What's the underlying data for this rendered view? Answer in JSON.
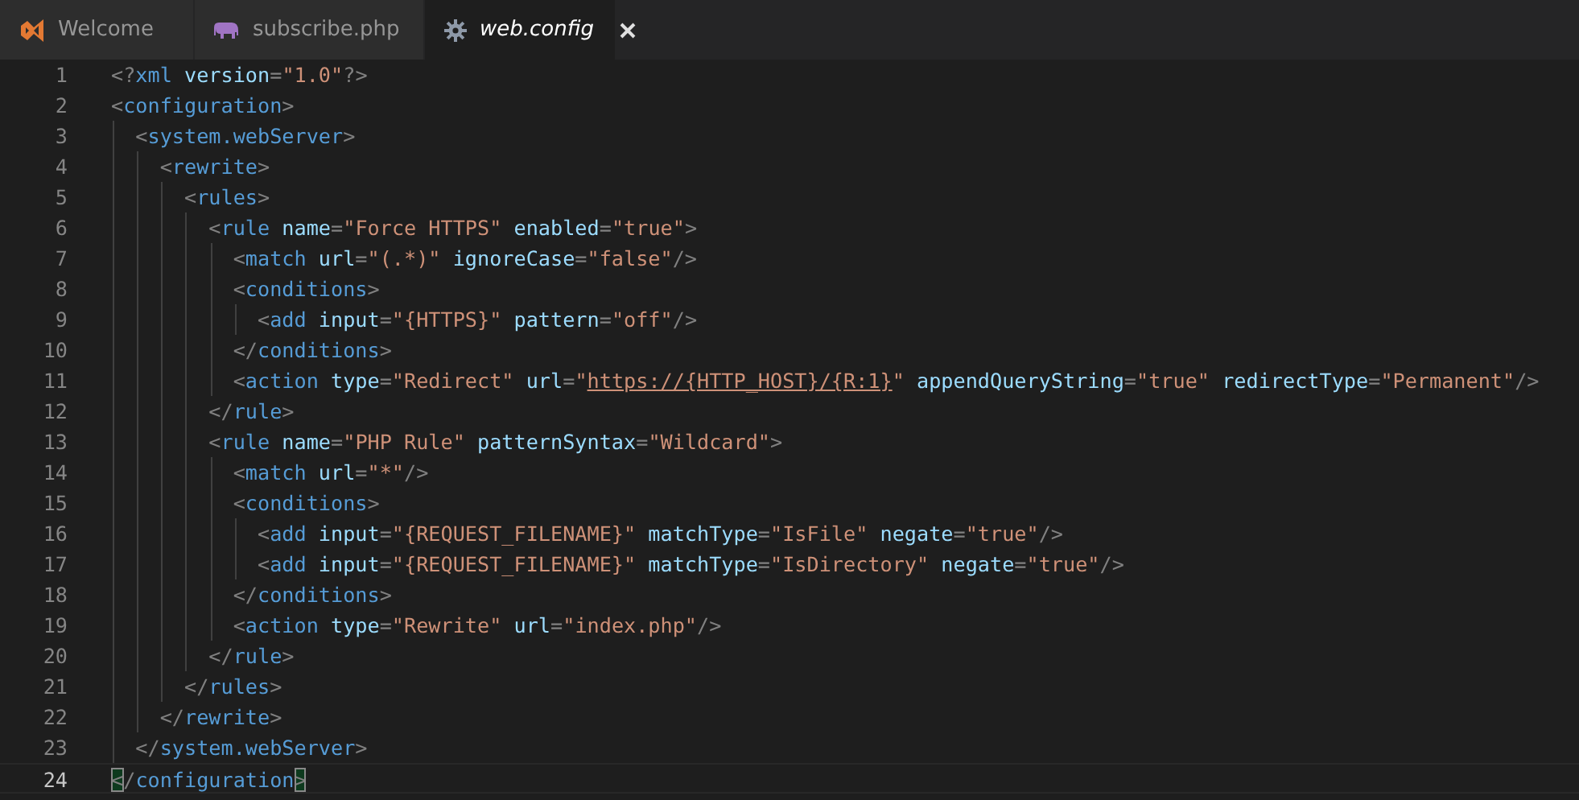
{
  "tabs": [
    {
      "label": "Welcome",
      "kind": "vs",
      "selected": false
    },
    {
      "label": "subscribe.php",
      "kind": "php",
      "selected": false
    },
    {
      "label": "web.config",
      "kind": "gear",
      "selected": true
    }
  ],
  "editor": {
    "lines": [
      {
        "number": "1",
        "current": false,
        "tokens": [
          {
            "kind": "punct",
            "text": "<?"
          },
          {
            "kind": "tag",
            "text": "xml"
          },
          {
            "kind": "attr",
            "text": " version"
          },
          {
            "kind": "punct",
            "text": "="
          },
          {
            "kind": "string",
            "text": "\"1.0\""
          },
          {
            "kind": "punct",
            "text": "?>"
          }
        ]
      },
      {
        "number": "2",
        "current": false,
        "tokens": [
          {
            "kind": "punct",
            "text": "<"
          },
          {
            "kind": "tag",
            "text": "configuration"
          },
          {
            "kind": "punct",
            "text": ">"
          }
        ]
      },
      {
        "number": "3",
        "current": false,
        "tokens": [
          {
            "kind": "punct",
            "text": "  <"
          },
          {
            "kind": "tag",
            "text": "system.webServer"
          },
          {
            "kind": "punct",
            "text": ">"
          }
        ]
      },
      {
        "number": "4",
        "current": false,
        "tokens": [
          {
            "kind": "punct",
            "text": "    <"
          },
          {
            "kind": "tag",
            "text": "rewrite"
          },
          {
            "kind": "punct",
            "text": ">"
          }
        ]
      },
      {
        "number": "5",
        "current": false,
        "tokens": [
          {
            "kind": "punct",
            "text": "      <"
          },
          {
            "kind": "tag",
            "text": "rules"
          },
          {
            "kind": "punct",
            "text": ">"
          }
        ]
      },
      {
        "number": "6",
        "current": false,
        "tokens": [
          {
            "kind": "punct",
            "text": "        <"
          },
          {
            "kind": "tag",
            "text": "rule"
          },
          {
            "kind": "attr",
            "text": " name"
          },
          {
            "kind": "punct",
            "text": "="
          },
          {
            "kind": "string",
            "text": "\"Force HTTPS\""
          },
          {
            "kind": "attr",
            "text": " enabled"
          },
          {
            "kind": "punct",
            "text": "="
          },
          {
            "kind": "string",
            "text": "\"true\""
          },
          {
            "kind": "punct",
            "text": ">"
          }
        ]
      },
      {
        "number": "7",
        "current": false,
        "tokens": [
          {
            "kind": "punct",
            "text": "          <"
          },
          {
            "kind": "tag",
            "text": "match"
          },
          {
            "kind": "attr",
            "text": " url"
          },
          {
            "kind": "punct",
            "text": "="
          },
          {
            "kind": "string",
            "text": "\"(.*)\""
          },
          {
            "kind": "attr",
            "text": " ignoreCase"
          },
          {
            "kind": "punct",
            "text": "="
          },
          {
            "kind": "string",
            "text": "\"false\""
          },
          {
            "kind": "punct",
            "text": "/>"
          }
        ]
      },
      {
        "number": "8",
        "current": false,
        "tokens": [
          {
            "kind": "punct",
            "text": "          <"
          },
          {
            "kind": "tag",
            "text": "conditions"
          },
          {
            "kind": "punct",
            "text": ">"
          }
        ]
      },
      {
        "number": "9",
        "current": false,
        "tokens": [
          {
            "kind": "punct",
            "text": "            <"
          },
          {
            "kind": "tag",
            "text": "add"
          },
          {
            "kind": "attr",
            "text": " input"
          },
          {
            "kind": "punct",
            "text": "="
          },
          {
            "kind": "string",
            "text": "\"{HTTPS}\""
          },
          {
            "kind": "attr",
            "text": " pattern"
          },
          {
            "kind": "punct",
            "text": "="
          },
          {
            "kind": "string",
            "text": "\"off\""
          },
          {
            "kind": "punct",
            "text": "/>"
          }
        ]
      },
      {
        "number": "10",
        "current": false,
        "tokens": [
          {
            "kind": "punct",
            "text": "          </"
          },
          {
            "kind": "tag",
            "text": "conditions"
          },
          {
            "kind": "punct",
            "text": ">"
          }
        ]
      },
      {
        "number": "11",
        "current": false,
        "tokens": [
          {
            "kind": "punct",
            "text": "          <"
          },
          {
            "kind": "tag",
            "text": "action"
          },
          {
            "kind": "attr",
            "text": " type"
          },
          {
            "kind": "punct",
            "text": "="
          },
          {
            "kind": "string",
            "text": "\"Redirect\""
          },
          {
            "kind": "attr",
            "text": " url"
          },
          {
            "kind": "punct",
            "text": "="
          },
          {
            "kind": "string",
            "text": "\""
          },
          {
            "kind": "link",
            "text": "https://{HTTP_HOST}/{R:1}"
          },
          {
            "kind": "string",
            "text": "\""
          },
          {
            "kind": "attr",
            "text": " appendQueryString"
          },
          {
            "kind": "punct",
            "text": "="
          },
          {
            "kind": "string",
            "text": "\"true\""
          },
          {
            "kind": "attr",
            "text": " redirectType"
          },
          {
            "kind": "punct",
            "text": "="
          },
          {
            "kind": "string",
            "text": "\"Permanent\""
          },
          {
            "kind": "punct",
            "text": "/>"
          }
        ]
      },
      {
        "number": "12",
        "current": false,
        "tokens": [
          {
            "kind": "punct",
            "text": "        </"
          },
          {
            "kind": "tag",
            "text": "rule"
          },
          {
            "kind": "punct",
            "text": ">"
          }
        ]
      },
      {
        "number": "13",
        "current": false,
        "tokens": [
          {
            "kind": "punct",
            "text": "        <"
          },
          {
            "kind": "tag",
            "text": "rule"
          },
          {
            "kind": "attr",
            "text": " name"
          },
          {
            "kind": "punct",
            "text": "="
          },
          {
            "kind": "string",
            "text": "\"PHP Rule\""
          },
          {
            "kind": "attr",
            "text": " patternSyntax"
          },
          {
            "kind": "punct",
            "text": "="
          },
          {
            "kind": "string",
            "text": "\"Wildcard\""
          },
          {
            "kind": "punct",
            "text": ">"
          }
        ]
      },
      {
        "number": "14",
        "current": false,
        "tokens": [
          {
            "kind": "punct",
            "text": "          <"
          },
          {
            "kind": "tag",
            "text": "match"
          },
          {
            "kind": "attr",
            "text": " url"
          },
          {
            "kind": "punct",
            "text": "="
          },
          {
            "kind": "string",
            "text": "\"*\""
          },
          {
            "kind": "punct",
            "text": "/>"
          }
        ]
      },
      {
        "number": "15",
        "current": false,
        "tokens": [
          {
            "kind": "punct",
            "text": "          <"
          },
          {
            "kind": "tag",
            "text": "conditions"
          },
          {
            "kind": "punct",
            "text": ">"
          }
        ]
      },
      {
        "number": "16",
        "current": false,
        "tokens": [
          {
            "kind": "punct",
            "text": "            <"
          },
          {
            "kind": "tag",
            "text": "add"
          },
          {
            "kind": "attr",
            "text": " input"
          },
          {
            "kind": "punct",
            "text": "="
          },
          {
            "kind": "string",
            "text": "\"{REQUEST_FILENAME}\""
          },
          {
            "kind": "attr",
            "text": " matchType"
          },
          {
            "kind": "punct",
            "text": "="
          },
          {
            "kind": "string",
            "text": "\"IsFile\""
          },
          {
            "kind": "attr",
            "text": " negate"
          },
          {
            "kind": "punct",
            "text": "="
          },
          {
            "kind": "string",
            "text": "\"true\""
          },
          {
            "kind": "punct",
            "text": "/>"
          }
        ]
      },
      {
        "number": "17",
        "current": false,
        "tokens": [
          {
            "kind": "punct",
            "text": "            <"
          },
          {
            "kind": "tag",
            "text": "add"
          },
          {
            "kind": "attr",
            "text": " input"
          },
          {
            "kind": "punct",
            "text": "="
          },
          {
            "kind": "string",
            "text": "\"{REQUEST_FILENAME}\""
          },
          {
            "kind": "attr",
            "text": " matchType"
          },
          {
            "kind": "punct",
            "text": "="
          },
          {
            "kind": "string",
            "text": "\"IsDirectory\""
          },
          {
            "kind": "attr",
            "text": " negate"
          },
          {
            "kind": "punct",
            "text": "="
          },
          {
            "kind": "string",
            "text": "\"true\""
          },
          {
            "kind": "punct",
            "text": "/>"
          }
        ]
      },
      {
        "number": "18",
        "current": false,
        "tokens": [
          {
            "kind": "punct",
            "text": "          </"
          },
          {
            "kind": "tag",
            "text": "conditions"
          },
          {
            "kind": "punct",
            "text": ">"
          }
        ]
      },
      {
        "number": "19",
        "current": false,
        "tokens": [
          {
            "kind": "punct",
            "text": "          <"
          },
          {
            "kind": "tag",
            "text": "action"
          },
          {
            "kind": "attr",
            "text": " type"
          },
          {
            "kind": "punct",
            "text": "="
          },
          {
            "kind": "string",
            "text": "\"Rewrite\""
          },
          {
            "kind": "attr",
            "text": " url"
          },
          {
            "kind": "punct",
            "text": "="
          },
          {
            "kind": "string",
            "text": "\"index.php\""
          },
          {
            "kind": "punct",
            "text": "/>"
          }
        ]
      },
      {
        "number": "20",
        "current": false,
        "tokens": [
          {
            "kind": "punct",
            "text": "        </"
          },
          {
            "kind": "tag",
            "text": "rule"
          },
          {
            "kind": "punct",
            "text": ">"
          }
        ]
      },
      {
        "number": "21",
        "current": false,
        "tokens": [
          {
            "kind": "punct",
            "text": "      </"
          },
          {
            "kind": "tag",
            "text": "rules"
          },
          {
            "kind": "punct",
            "text": ">"
          }
        ]
      },
      {
        "number": "22",
        "current": false,
        "tokens": [
          {
            "kind": "punct",
            "text": "    </"
          },
          {
            "kind": "tag",
            "text": "rewrite"
          },
          {
            "kind": "punct",
            "text": ">"
          }
        ]
      },
      {
        "number": "23",
        "current": false,
        "tokens": [
          {
            "kind": "punct",
            "text": "  </"
          },
          {
            "kind": "tag",
            "text": "system.webServer"
          },
          {
            "kind": "punct",
            "text": ">"
          }
        ]
      },
      {
        "number": "24",
        "current": true,
        "tokens": [
          {
            "kind": "bracket",
            "text": "<"
          },
          {
            "kind": "punct",
            "text": "/"
          },
          {
            "kind": "tag",
            "text": "configuration"
          },
          {
            "kind": "bracket",
            "text": ">"
          }
        ]
      }
    ]
  }
}
